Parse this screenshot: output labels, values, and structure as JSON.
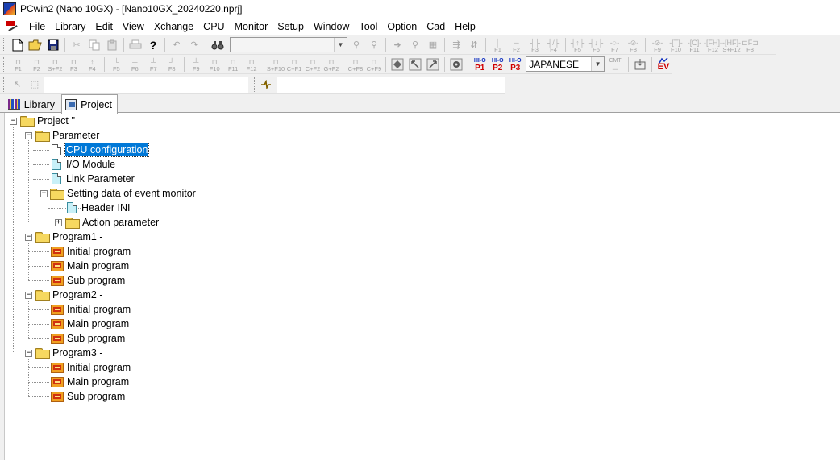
{
  "window": {
    "title": "PCwin2 (Nano 10GX)  - [Nano10GX_20240220.nprj]"
  },
  "menu": [
    {
      "label": "File"
    },
    {
      "label": "Library"
    },
    {
      "label": "Edit"
    },
    {
      "label": "View"
    },
    {
      "label": "Xchange"
    },
    {
      "label": "CPU"
    },
    {
      "label": "Monitor"
    },
    {
      "label": "Setup"
    },
    {
      "label": "Window"
    },
    {
      "label": "Tool"
    },
    {
      "label": "Option"
    },
    {
      "label": "Cad"
    },
    {
      "label": "Help"
    }
  ],
  "toolbar1": {
    "fkeys": [
      "F1",
      "F2",
      "F3",
      "F4",
      "F5",
      "F6",
      "F7",
      "F8",
      "F9",
      "F10",
      "F11",
      "F12",
      "S+F12",
      "F8"
    ]
  },
  "toolbar2": {
    "fkeys": [
      "F1",
      "F2",
      "S+F2",
      "F3",
      "F4",
      "F5",
      "F6",
      "F7",
      "F8",
      "F9",
      "F10",
      "F11",
      "F12",
      "S+F10",
      "C+F1",
      "C+F2",
      "G+F2",
      "C+F8",
      "C+F9"
    ],
    "pkeys": [
      {
        "top": "HI-O",
        "bot": "P1"
      },
      {
        "top": "HI-O",
        "bot": "P2"
      },
      {
        "top": "HI-O",
        "bot": "P3"
      }
    ],
    "language": "JAPANESE",
    "cmt_label": "CMT",
    "ev_label": "EV"
  },
  "tabs": [
    {
      "label": "Library",
      "active": false
    },
    {
      "label": "Project",
      "active": true
    }
  ],
  "tree": {
    "root": "Project ''",
    "parameter": "Parameter",
    "cpu_config": "CPU configuration",
    "io_module": "I/O Module",
    "link_param": "Link Parameter",
    "event_monitor": "Setting data of event monitor",
    "header_ini": "Header INI",
    "action_param": "Action parameter",
    "programs": [
      {
        "name": "Program1 -",
        "children": [
          "Initial program",
          "Main program",
          "Sub program"
        ]
      },
      {
        "name": "Program2 -",
        "children": [
          "Initial program",
          "Main program",
          "Sub program"
        ]
      },
      {
        "name": "Program3 -",
        "children": [
          "Initial program",
          "Main program",
          "Sub program"
        ]
      }
    ]
  }
}
